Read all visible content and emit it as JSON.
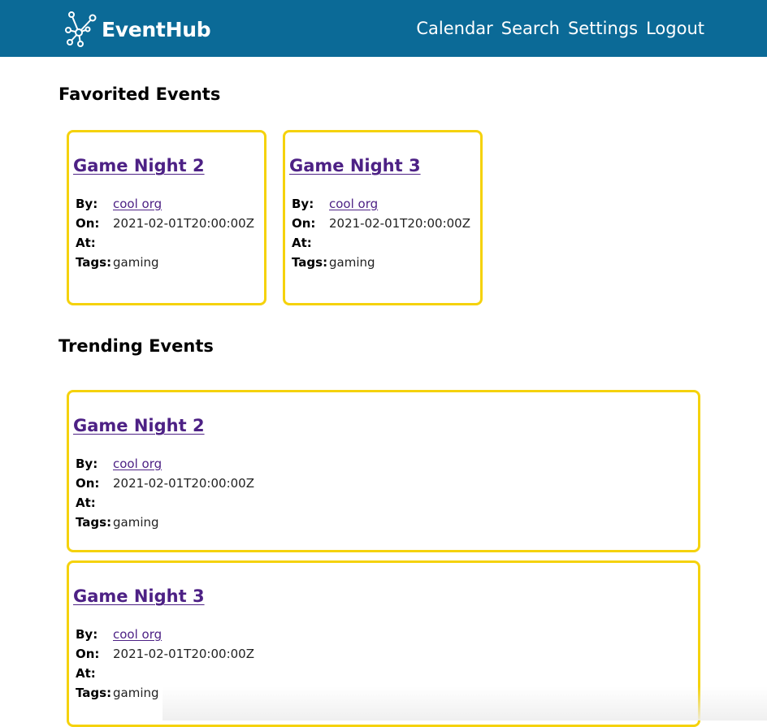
{
  "navbar": {
    "brand": "EventHub",
    "logo_icon": "network-nodes-icon",
    "links": [
      "Calendar",
      "Search",
      "Settings",
      "Logout"
    ]
  },
  "favorited": {
    "heading": "Favorited Events",
    "events": [
      {
        "title": "Game Night 2",
        "by_label": "By:",
        "by": "cool org",
        "on_label": "On:",
        "on": "2021-02-01T20:00:00Z",
        "at_label": "At:",
        "at": "",
        "tags_label": "Tags:",
        "tags": "gaming"
      },
      {
        "title": "Game Night 3",
        "by_label": "By:",
        "by": "cool org",
        "on_label": "On:",
        "on": "2021-02-01T20:00:00Z",
        "at_label": "At:",
        "at": "",
        "tags_label": "Tags:",
        "tags": "gaming"
      }
    ]
  },
  "trending": {
    "heading": "Trending Events",
    "events": [
      {
        "title": "Game Night 2",
        "by_label": "By:",
        "by": "cool org",
        "on_label": "On:",
        "on": "2021-02-01T20:00:00Z",
        "at_label": "At:",
        "at": "",
        "tags_label": "Tags:",
        "tags": "gaming"
      },
      {
        "title": "Game Night 3",
        "by_label": "By:",
        "by": "cool org",
        "on_label": "On:",
        "on": "2021-02-01T20:00:00Z",
        "at_label": "At:",
        "at": "",
        "tags_label": "Tags:",
        "tags": "gaming"
      }
    ]
  },
  "colors": {
    "navbar_bg": "#0b6a97",
    "card_border": "#f5d20c",
    "link": "#4d2185"
  }
}
